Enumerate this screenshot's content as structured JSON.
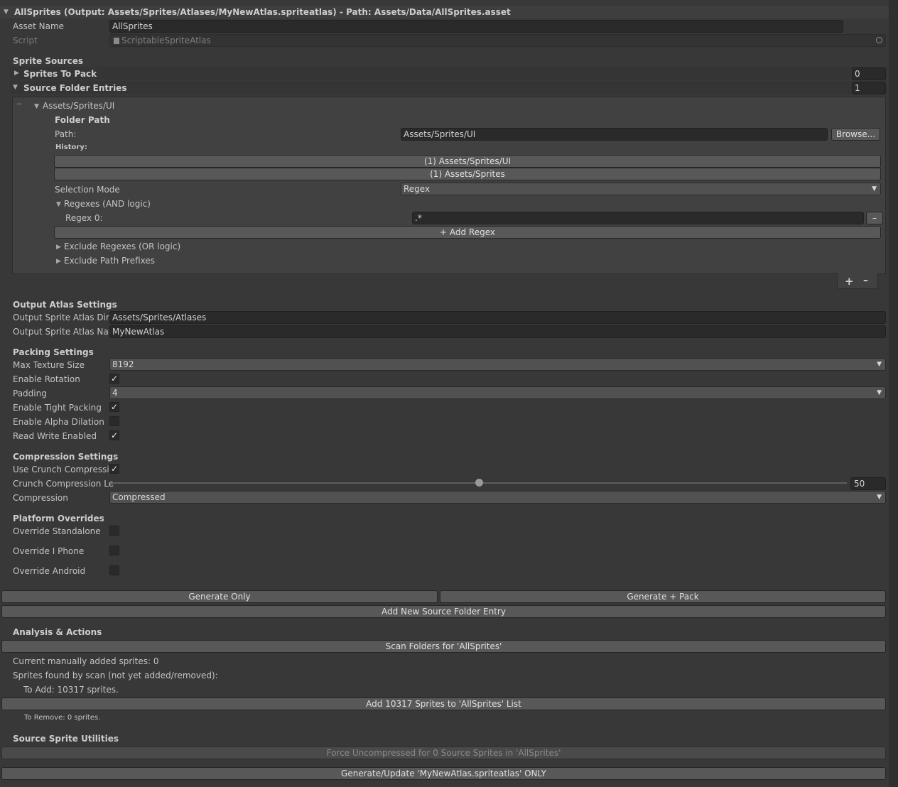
{
  "title": "AllSprites (Output: Assets/Sprites/Atlases/MyNewAtlas.spriteatlas) - Path: Assets/Data/AllSprites.asset",
  "asset": {
    "name_label": "Asset Name",
    "name_value": "AllSprites",
    "script_label": "Script",
    "script_value": "ScriptableSpriteAtlas"
  },
  "sprite_sources": {
    "header": "Sprite Sources",
    "sprites_to_pack_label": "Sprites To Pack",
    "sprites_to_pack_count": "0",
    "source_folder_entries_label": "Source Folder Entries",
    "source_folder_entries_count": "1",
    "entry": {
      "title": "Assets/Sprites/UI",
      "folder_path_header": "Folder Path",
      "path_label": "Path:",
      "path_value": "Assets/Sprites/UI",
      "browse_label": "Browse...",
      "history_label": "History:",
      "history": [
        "(1) Assets/Sprites/UI",
        "(1) Assets/Sprites"
      ],
      "selection_mode_label": "Selection Mode",
      "selection_mode_value": "Regex",
      "regexes_label": "Regexes (AND logic)",
      "regex0_label": "Regex 0:",
      "regex0_value": ".*",
      "remove_symbol": "–",
      "add_regex_label": "+ Add Regex",
      "exclude_regexes_label": "Exclude Regexes (OR logic)",
      "exclude_prefixes_label": "Exclude Path Prefixes"
    },
    "plus_symbol": "+",
    "minus_symbol": "–"
  },
  "output": {
    "header": "Output Atlas Settings",
    "dir_label": "Output Sprite Atlas Direc",
    "dir_value": "Assets/Sprites/Atlases",
    "name_label": "Output Sprite Atlas Nam",
    "name_value": "MyNewAtlas"
  },
  "packing": {
    "header": "Packing Settings",
    "max_texture_label": "Max Texture Size",
    "max_texture_value": "8192",
    "rotation_label": "Enable Rotation",
    "rotation_checked": true,
    "padding_label": "Padding",
    "padding_value": "4",
    "tight_label": "Enable Tight Packing",
    "tight_checked": true,
    "alpha_label": "Enable Alpha Dilation",
    "alpha_checked": false,
    "rw_label": "Read Write Enabled",
    "rw_checked": true
  },
  "compression": {
    "header": "Compression Settings",
    "crunch_label": "Use Crunch Compressio",
    "crunch_checked": true,
    "level_label": "Crunch Compression Le",
    "level_value": "50",
    "level_fraction": 0.5,
    "compression_label": "Compression",
    "compression_value": "Compressed"
  },
  "platform": {
    "header": "Platform Overrides",
    "standalone_label": "Override Standalone",
    "standalone_checked": false,
    "iphone_label": "Override I Phone",
    "iphone_checked": false,
    "android_label": "Override Android",
    "android_checked": false
  },
  "actions": {
    "generate_only": "Generate Only",
    "generate_pack": "Generate + Pack",
    "add_source_folder": "Add New Source Folder Entry"
  },
  "analysis": {
    "header": "Analysis & Actions",
    "scan_button": "Scan Folders for 'AllSprites'",
    "manual_count": "Current manually added sprites: 0",
    "found_by_scan": "Sprites found by scan (not yet added/removed):",
    "to_add": "To Add: 10317 sprites.",
    "add_button": "Add 10317 Sprites to 'AllSprites' List",
    "to_remove": "To Remove: 0 sprites."
  },
  "utilities": {
    "header": "Source Sprite Utilities",
    "force_uncompressed": "Force Uncompressed for 0 Source Sprites in 'AllSprites'",
    "generate_update": "Generate/Update 'MyNewAtlas.spriteatlas' ONLY"
  },
  "colors": {
    "background": "#383838",
    "field": "#2a2a2a",
    "button": "#585858",
    "header_bar": "#3e3e3e"
  }
}
